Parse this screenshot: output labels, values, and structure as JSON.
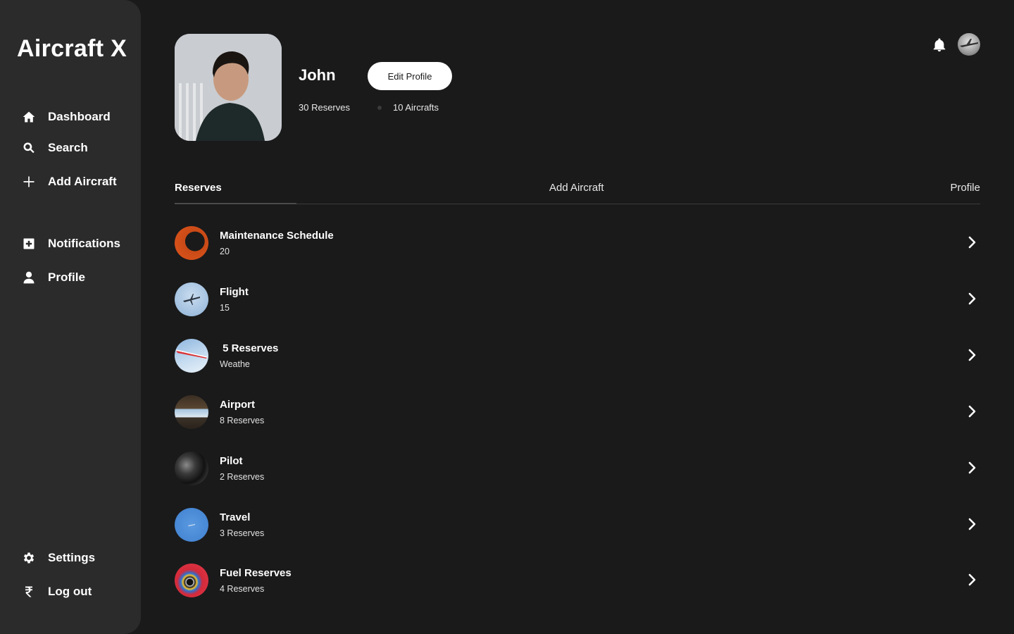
{
  "app": {
    "title": "Aircraft X"
  },
  "sidebar": {
    "items": [
      {
        "label": "Dashboard",
        "icon": "home-icon"
      },
      {
        "label": "Search",
        "icon": "search-icon"
      },
      {
        "label": "Add Aircraft",
        "icon": "plus-icon"
      },
      {
        "label": "Notifications",
        "icon": "plus-box-icon"
      },
      {
        "label": "Profile",
        "icon": "user-icon"
      },
      {
        "label": "Settings",
        "icon": "gear-icon"
      },
      {
        "label": "Log out",
        "icon": "rupee-icon"
      }
    ]
  },
  "profile": {
    "name": "John",
    "edit_label": "Edit Profile",
    "reserves_stat": "30 Reserves",
    "aircrafts_stat": "10 Aircrafts"
  },
  "tabs": [
    {
      "label": "Reserves",
      "active": true
    },
    {
      "label": "Add Aircraft",
      "active": false
    },
    {
      "label": "Profile",
      "active": false
    }
  ],
  "list": [
    {
      "title": "Maintenance Schedule",
      "subtitle": "20"
    },
    {
      "title": "Flight",
      "subtitle": "15"
    },
    {
      "title": " 5 Reserves",
      "subtitle": "Weathe"
    },
    {
      "title": "Airport",
      "subtitle": "8 Reserves"
    },
    {
      "title": "Pilot",
      "subtitle": "2 Reserves"
    },
    {
      "title": "Travel",
      "subtitle": "3 Reserves"
    },
    {
      "title": "Fuel Reserves",
      "subtitle": "4 Reserves"
    }
  ],
  "colors": {
    "background": "#1a1a1b",
    "sidebar": "#2b2b2c",
    "text": "#ffffff",
    "button": "#ffffff"
  }
}
